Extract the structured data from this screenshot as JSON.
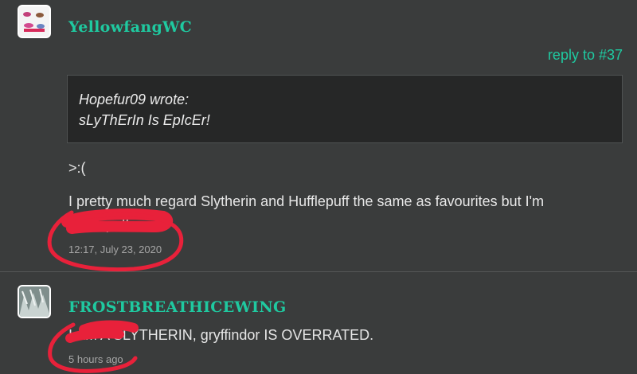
{
  "post1": {
    "username": "YellowfangWC",
    "reply_link": "reply to #37",
    "quote": {
      "author_line": "Hopefur09 wrote:",
      "text": "sLyThErIn Is EpIcEr!"
    },
    "line1": ">:(",
    "line2": "I pretty much regard Slytherin and Hufflepuff the same as favourites but I'm",
    "line3": "Hufflepuff so",
    "timestamp": "12:17, July 23, 2020"
  },
  "post2": {
    "username": "FROSTBREATHICEWING",
    "text": "I AM A SLYTHERIN, gryffindor IS OVERRATED.",
    "timestamp": "5 hours ago"
  },
  "colors": {
    "background": "#3a3c3c",
    "accent": "#1fc9a0",
    "quote_background": "#262727",
    "annotation_red": "#e8213a"
  },
  "icons": {
    "avatar1": "cartoon-cats-avatar",
    "avatar2": "frosty-cat-avatar"
  }
}
